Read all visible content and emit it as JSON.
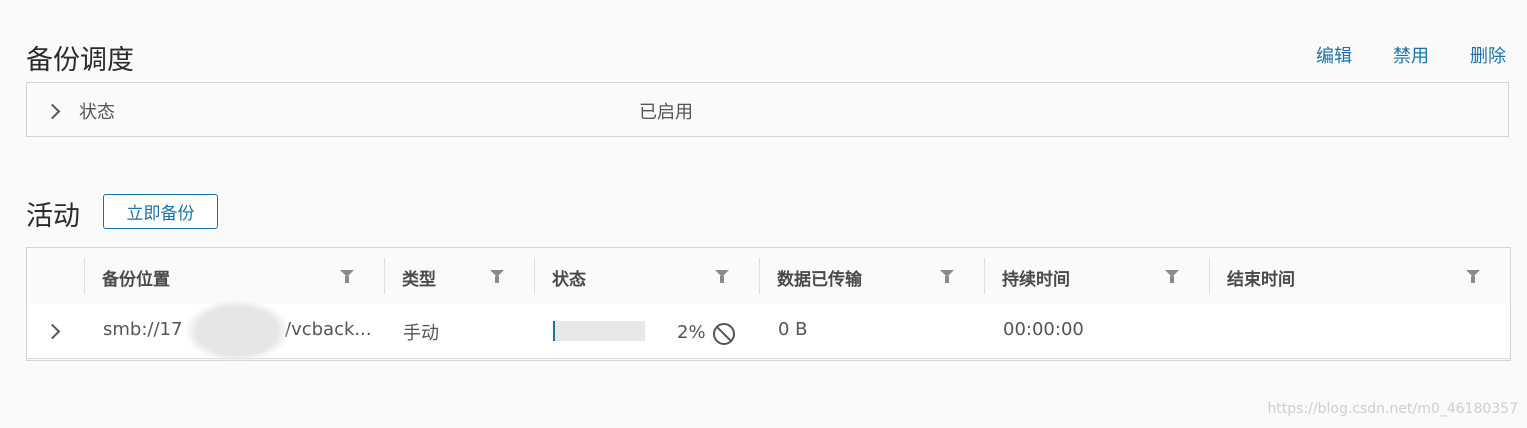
{
  "schedule": {
    "title": "备份调度",
    "actions": {
      "edit": "编辑",
      "disable": "禁用",
      "delete": "删除"
    },
    "status_label": "状态",
    "status_value": "已启用"
  },
  "activity": {
    "title": "活动",
    "backup_now_label": "立即备份",
    "columns": [
      "备份位置",
      "类型",
      "状态",
      "数据已传输",
      "持续时间",
      "结束时间"
    ],
    "rows": [
      {
        "location_prefix": "smb://17",
        "location_suffix": "/vcback...",
        "type": "手动",
        "progress_percent": 2,
        "progress_text": "2%",
        "data_transferred": "0 B",
        "duration": "00:00:00",
        "end_time": ""
      }
    ]
  },
  "icons": {
    "expand": "chevron-right-icon",
    "filter": "filter-icon",
    "cancel": "cancel-icon"
  },
  "colors": {
    "accent": "#1a73a8",
    "progress_track": "#e8e8e8"
  },
  "watermark": "https://blog.csdn.net/m0_46180357"
}
